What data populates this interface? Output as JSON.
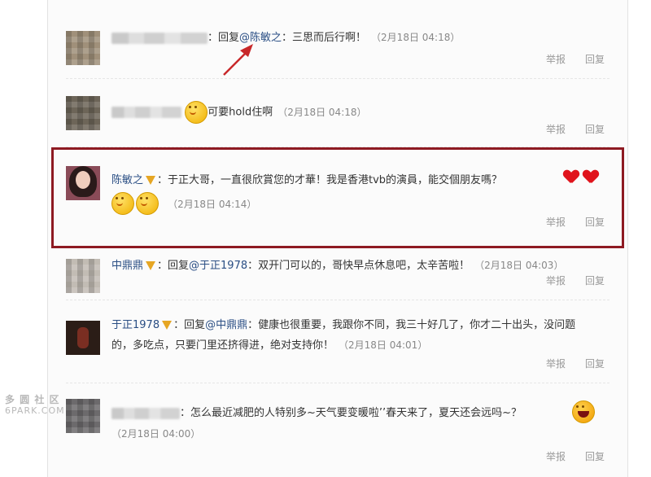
{
  "watermark": {
    "line1": "多 圆 社 区",
    "line2": "6PARK.COM"
  },
  "actions": {
    "report": "举报",
    "reply": "回复"
  },
  "comments": [
    {
      "user": "",
      "text_pre": "：回复",
      "mention": "@陈敏之",
      "text": "：三思而后行啊！",
      "time": "（2月18日 04:18）"
    },
    {
      "user": "",
      "text": "可要hold住啊",
      "time": "（2月18日 04:18）"
    },
    {
      "user": "陈敏之",
      "text": "：于正大哥，一直很欣賞您的才華！我是香港tvb的演員，能交個朋友嗎？",
      "time": "（2月18日 04:14）"
    },
    {
      "user": "中鼎鼎",
      "text_pre": "：回复",
      "mention": "@于正1978",
      "text": "：双开门可以的，哥快早点休息吧，太辛苦啦！",
      "time": "（2月18日 04:03）"
    },
    {
      "user": "于正1978",
      "text_pre": "：回复",
      "mention": "@中鼎鼎",
      "text": "：健康也很重要，我跟你不同，我三十好几了，你才二十出头，没问题的，多吃点，只要门里还挤得进，绝对支持你！",
      "time": "（2月18日 04:01）"
    },
    {
      "user": "",
      "text": "：怎么最近减肥的人特别多~天气要变暖啦’’春天来了，夏天还会远吗~？",
      "time": "（2月18日 04:00）"
    }
  ],
  "colors": {
    "highlight_border": "#8e1a22",
    "arrow": "#c8282a",
    "link": "#2a4e84"
  },
  "icons": [
    "grin-emoji-icon",
    "heart-icon",
    "laugh-emoji-icon",
    "v-badge-icon"
  ]
}
